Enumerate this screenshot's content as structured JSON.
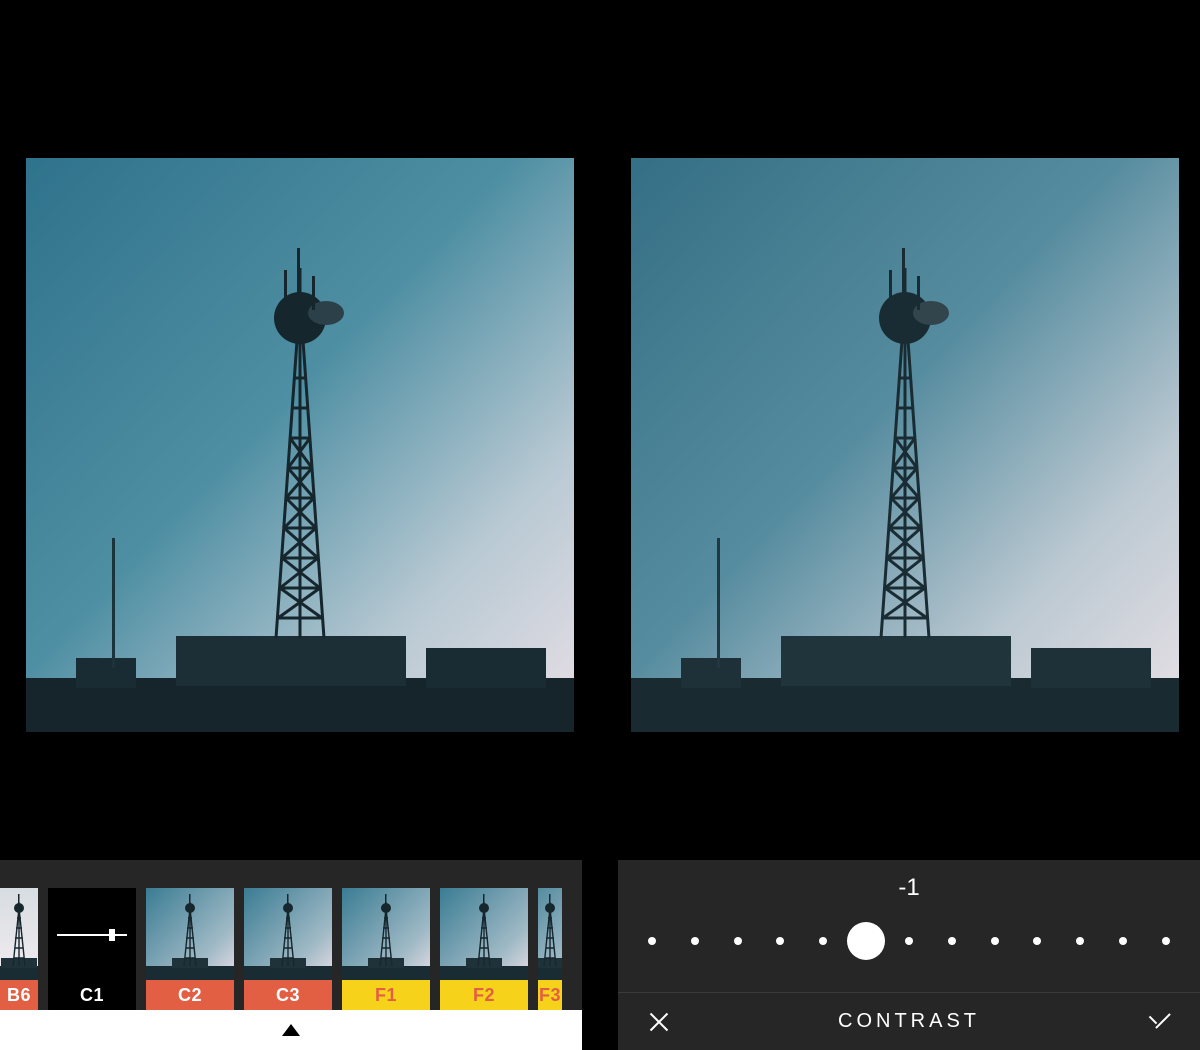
{
  "slider": {
    "label": "CONTRAST",
    "value": "-1",
    "min": -6,
    "max": 6,
    "ticks": 13,
    "knob_index": 5
  },
  "filters": [
    {
      "code": "B6",
      "label_bg": "#e35f43",
      "label_fg": "#ffffff",
      "partial": "left",
      "thumb_variant": "fade"
    },
    {
      "code": "C1",
      "label_bg": "#000000",
      "label_fg": "#ffffff",
      "selected": true
    },
    {
      "code": "C2",
      "label_bg": "#e35f43",
      "label_fg": "#ffffff"
    },
    {
      "code": "C3",
      "label_bg": "#e35f43",
      "label_fg": "#ffffff"
    },
    {
      "code": "F1",
      "label_bg": "#f6d31a",
      "label_fg": "#e35f43"
    },
    {
      "code": "F2",
      "label_bg": "#f6d31a",
      "label_fg": "#e35f43"
    },
    {
      "code": "F3",
      "label_bg": "#f6d31a",
      "label_fg": "#e35f43",
      "partial": "right"
    }
  ],
  "icons": {
    "cancel": "close-icon",
    "confirm": "check-icon",
    "caret": "caret-up-icon"
  }
}
